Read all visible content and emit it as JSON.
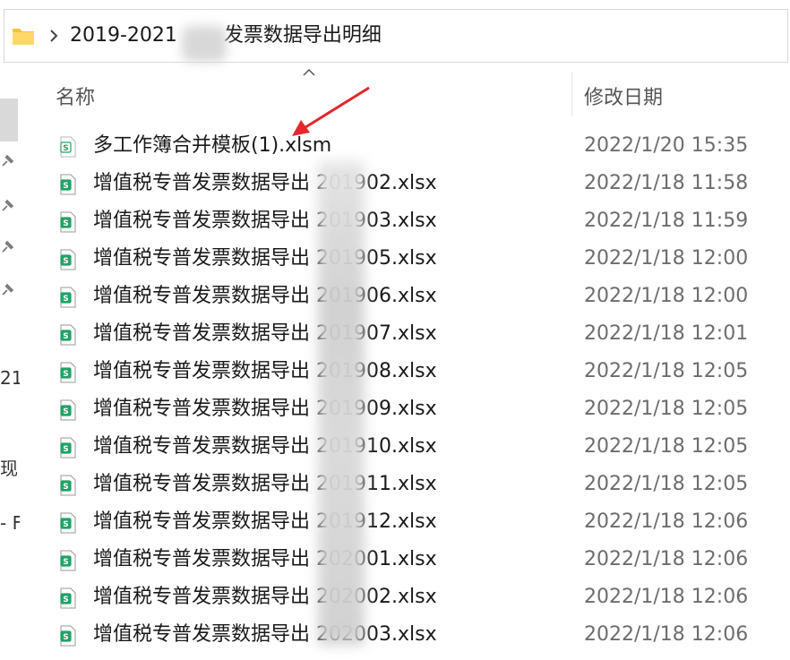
{
  "address_bar": {
    "path_prefix": "2019-2021",
    "path_suffix": "发票数据导出明细"
  },
  "nav": {
    "fragments": [
      "21",
      "现",
      "- F"
    ]
  },
  "columns": {
    "name": "名称",
    "modified": "修改日期"
  },
  "files": [
    {
      "name": "多工作簿合并模板(1).xlsm",
      "date": "2022/1/20 15:35",
      "type": "xlsm"
    },
    {
      "name": "增值税专普发票数据导出    201902.xlsx",
      "date": "2022/1/18 11:58",
      "type": "xlsx"
    },
    {
      "name": "增值税专普发票数据导出    201903.xlsx",
      "date": "2022/1/18 11:59",
      "type": "xlsx"
    },
    {
      "name": "增值税专普发票数据导出    201905.xlsx",
      "date": "2022/1/18 12:00",
      "type": "xlsx"
    },
    {
      "name": "增值税专普发票数据导出    201906.xlsx",
      "date": "2022/1/18 12:00",
      "type": "xlsx"
    },
    {
      "name": "增值税专普发票数据导出    201907.xlsx",
      "date": "2022/1/18 12:01",
      "type": "xlsx"
    },
    {
      "name": "增值税专普发票数据导出    201908.xlsx",
      "date": "2022/1/18 12:05",
      "type": "xlsx"
    },
    {
      "name": "增值税专普发票数据导出    201909.xlsx",
      "date": "2022/1/18 12:05",
      "type": "xlsx"
    },
    {
      "name": "增值税专普发票数据导出    201910.xlsx",
      "date": "2022/1/18 12:05",
      "type": "xlsx"
    },
    {
      "name": "增值税专普发票数据导出    201911.xlsx",
      "date": "2022/1/18 12:05",
      "type": "xlsx"
    },
    {
      "name": "增值税专普发票数据导出    201912.xlsx",
      "date": "2022/1/18 12:06",
      "type": "xlsx"
    },
    {
      "name": "增值税专普发票数据导出    202001.xlsx",
      "date": "2022/1/18 12:06",
      "type": "xlsx"
    },
    {
      "name": "增值税专普发票数据导出    202002.xlsx",
      "date": "2022/1/18 12:06",
      "type": "xlsx"
    },
    {
      "name": "增值税专普发票数据导出    202003.xlsx",
      "date": "2022/1/18 12:06",
      "type": "xlsx"
    }
  ],
  "colors": {
    "excel_green": "#21a366",
    "annotation_red": "#e5262b"
  }
}
